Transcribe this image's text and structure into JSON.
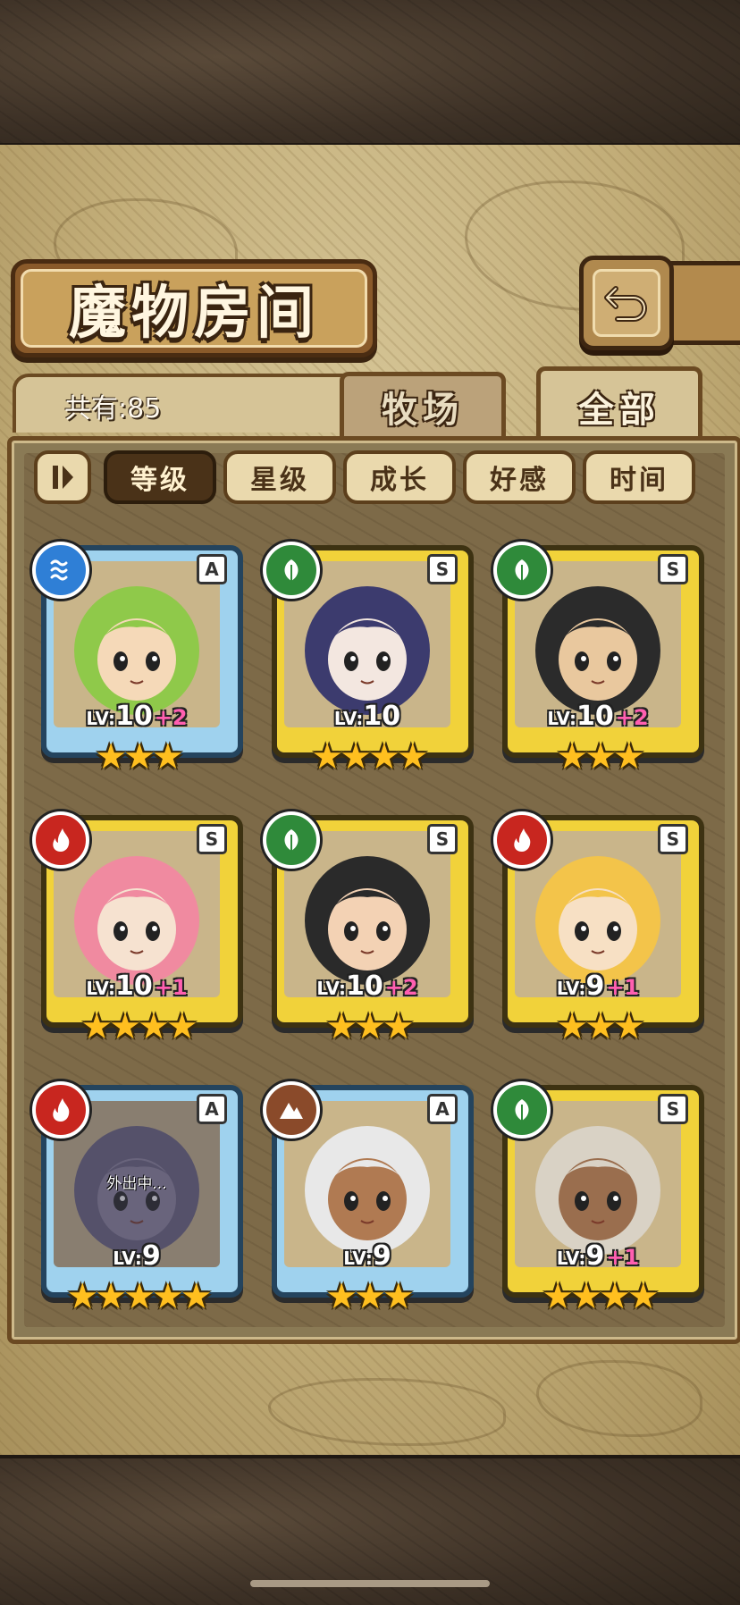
{
  "header": {
    "title": "魔物房间"
  },
  "summary": {
    "count_label": "共有:85"
  },
  "view_tabs": [
    {
      "label": "牧场",
      "selected": false
    },
    {
      "label": "全部",
      "selected": true
    }
  ],
  "sort_options": [
    {
      "label": "等级",
      "selected": true
    },
    {
      "label": "星级",
      "selected": false
    },
    {
      "label": "成长",
      "selected": false
    },
    {
      "label": "好感",
      "selected": false
    },
    {
      "label": "时间",
      "selected": false
    }
  ],
  "monsters": [
    {
      "rank": "A",
      "element": "water",
      "frame": "blue",
      "level": "10",
      "bonus": "+2",
      "stars": 3,
      "status": ""
    },
    {
      "rank": "S",
      "element": "wood",
      "frame": "gold",
      "level": "10",
      "bonus": "",
      "stars": 4,
      "status": ""
    },
    {
      "rank": "S",
      "element": "wood",
      "frame": "gold",
      "level": "10",
      "bonus": "+2",
      "stars": 3,
      "status": ""
    },
    {
      "rank": "S",
      "element": "fire",
      "frame": "gold",
      "level": "10",
      "bonus": "+1",
      "stars": 4,
      "status": ""
    },
    {
      "rank": "S",
      "element": "wood",
      "frame": "gold",
      "level": "10",
      "bonus": "+2",
      "stars": 3,
      "status": ""
    },
    {
      "rank": "S",
      "element": "fire",
      "frame": "gold",
      "level": "9",
      "bonus": "+1",
      "stars": 3,
      "status": ""
    },
    {
      "rank": "A",
      "element": "fire",
      "frame": "blue",
      "level": "9",
      "bonus": "",
      "stars": 5,
      "status": "外出中..."
    },
    {
      "rank": "A",
      "element": "earth",
      "frame": "blue",
      "level": "9",
      "bonus": "",
      "stars": 3,
      "status": ""
    },
    {
      "rank": "S",
      "element": "wood",
      "frame": "gold",
      "level": "9",
      "bonus": "+1",
      "stars": 4,
      "status": ""
    }
  ],
  "colors": {
    "water": "#2f7fd6",
    "wood": "#2f8a3a",
    "fire": "#c8261f",
    "earth": "#8a4a2a",
    "star": "#ffbf1f",
    "bonus": "#ff5fb0"
  }
}
